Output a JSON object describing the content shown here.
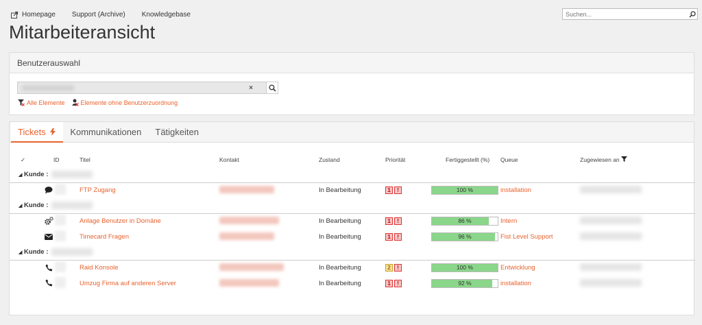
{
  "nav": {
    "homepage": "Homepage",
    "support": "Support (Archive)",
    "knowledgebase": "Knowledgebase",
    "search_placeholder": "Suchen..."
  },
  "page_title": "Mitarbeiteransicht",
  "user_panel": {
    "title": "Benutzerauswahl",
    "clear": "×",
    "all_elements": "Alle Elemente",
    "unassigned_elements": "Elemente ohne Benutzerzuordnung"
  },
  "tabs": [
    {
      "label": "Tickets"
    },
    {
      "label": "Kommunikationen"
    },
    {
      "label": "Tätigkeiten"
    }
  ],
  "columns": {
    "check": "✓",
    "id": "ID",
    "title": "Titel",
    "contact": "Kontakt",
    "state": "Zustand",
    "priority": "Priorität",
    "progress": "Fertiggestellt (%)",
    "queue": "Queue",
    "assigned": "Zugewiesen an"
  },
  "groups": [
    {
      "label": "Kunde :",
      "rows": [
        {
          "icon": "comment-icon",
          "title": "FTP Zugang",
          "state": "In Bearbeitung",
          "priority": "1",
          "progress": 100,
          "progress_label": "100 %",
          "queue": "installation"
        }
      ]
    },
    {
      "label": "Kunde :",
      "rows": [
        {
          "icon": "gears-icon",
          "title": "Anlage Benutzer in Domäne",
          "state": "In Bearbeitung",
          "priority": "1",
          "progress": 86,
          "progress_label": "86 %",
          "queue": "Intern"
        },
        {
          "icon": "envelope-icon",
          "title": "Timecard Fragen",
          "state": "In Bearbeitung",
          "priority": "1",
          "progress": 96,
          "progress_label": "96 %",
          "queue": "Fist Level Support"
        }
      ]
    },
    {
      "label": "Kunde :",
      "rows": [
        {
          "icon": "phone-icon",
          "title": "Raid Konsole",
          "state": "In Bearbeitung",
          "priority": "2",
          "progress": 100,
          "progress_label": "100 %",
          "queue": "Entwicklung"
        },
        {
          "icon": "phone-icon",
          "title": "Umzug Firma auf anderen Server",
          "state": "In Bearbeitung",
          "priority": "1",
          "progress": 92,
          "progress_label": "92 %",
          "queue": "installation"
        }
      ]
    }
  ],
  "colors": {
    "accent": "#e8622d",
    "progress": "#8ad68a"
  }
}
